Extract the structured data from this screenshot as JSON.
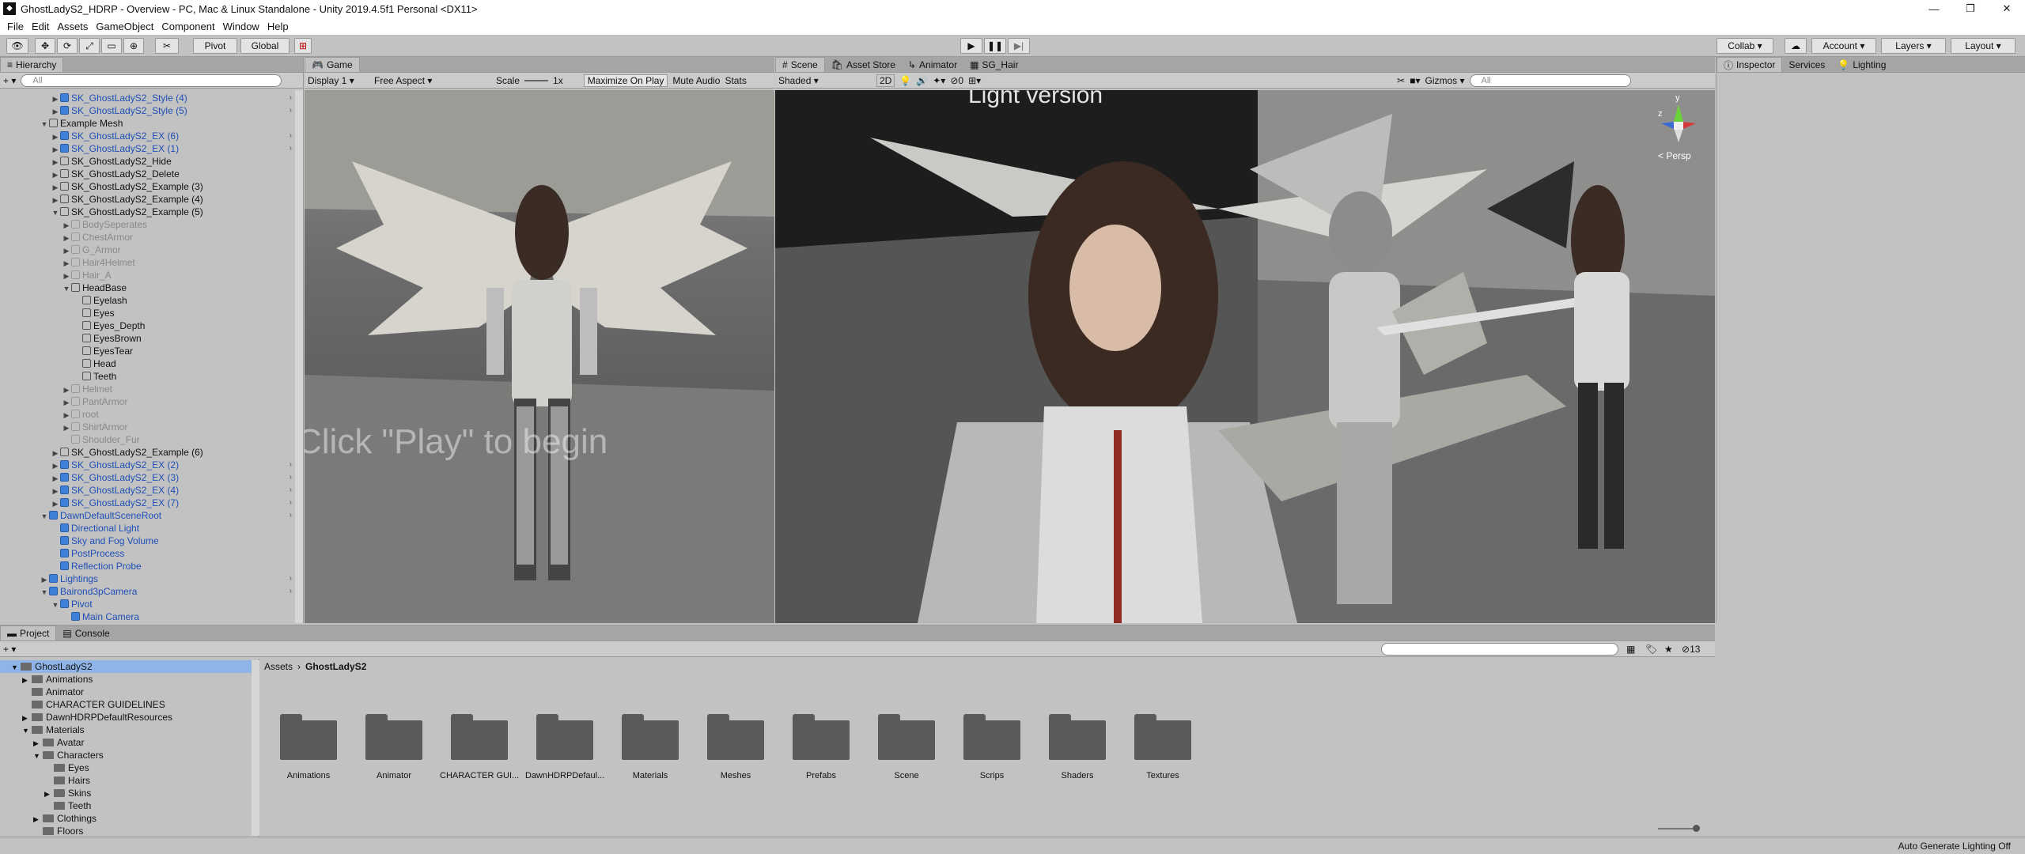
{
  "window": {
    "title": "GhostLadyS2_HDRP - Overview - PC, Mac & Linux Standalone - Unity 2019.4.5f1 Personal <DX11>"
  },
  "menu": [
    "File",
    "Edit",
    "Assets",
    "GameObject",
    "Component",
    "Window",
    "Help"
  ],
  "toolbar": {
    "pivot": "Pivot",
    "global": "Global",
    "collab": "Collab",
    "account": "Account",
    "layers": "Layers",
    "layout": "Layout"
  },
  "hierarchy": {
    "tab": "Hierarchy",
    "search_placeholder": "All",
    "rows": [
      {
        "label": "SK_GhostLadyS2_Style (4)",
        "indent": 1,
        "style": "blue",
        "arrow": "▶",
        "more": true
      },
      {
        "label": "SK_GhostLadyS2_Style (5)",
        "indent": 1,
        "style": "blue",
        "arrow": "▶",
        "more": true
      },
      {
        "label": "Example Mesh",
        "indent": 0,
        "style": "",
        "arrow": "▼",
        "more": false
      },
      {
        "label": "SK_GhostLadyS2_EX (6)",
        "indent": 1,
        "style": "blue",
        "arrow": "▶",
        "more": true
      },
      {
        "label": "SK_GhostLadyS2_EX (1)",
        "indent": 1,
        "style": "blue",
        "arrow": "▶",
        "more": true
      },
      {
        "label": "SK_GhostLadyS2_Hide",
        "indent": 1,
        "style": "",
        "arrow": "▶",
        "more": false
      },
      {
        "label": "SK_GhostLadyS2_Delete",
        "indent": 1,
        "style": "",
        "arrow": "▶",
        "more": false
      },
      {
        "label": "SK_GhostLadyS2_Example (3)",
        "indent": 1,
        "style": "",
        "arrow": "▶",
        "more": false
      },
      {
        "label": "SK_GhostLadyS2_Example (4)",
        "indent": 1,
        "style": "",
        "arrow": "▶",
        "more": false
      },
      {
        "label": "SK_GhostLadyS2_Example (5)",
        "indent": 1,
        "style": "",
        "arrow": "▼",
        "more": false
      },
      {
        "label": "BodySeperates",
        "indent": 2,
        "style": "grey",
        "arrow": "▶",
        "more": false
      },
      {
        "label": "ChestArmor",
        "indent": 2,
        "style": "grey",
        "arrow": "▶",
        "more": false
      },
      {
        "label": "G_Armor",
        "indent": 2,
        "style": "grey",
        "arrow": "▶",
        "more": false
      },
      {
        "label": "Hair4Helmet",
        "indent": 2,
        "style": "grey",
        "arrow": "▶",
        "more": false
      },
      {
        "label": "Hair_A",
        "indent": 2,
        "style": "grey",
        "arrow": "▶",
        "more": false
      },
      {
        "label": "HeadBase",
        "indent": 2,
        "style": "",
        "arrow": "▼",
        "more": false
      },
      {
        "label": "Eyelash",
        "indent": 3,
        "style": "",
        "arrow": "",
        "more": false
      },
      {
        "label": "Eyes",
        "indent": 3,
        "style": "",
        "arrow": "",
        "more": false
      },
      {
        "label": "Eyes_Depth",
        "indent": 3,
        "style": "",
        "arrow": "",
        "more": false
      },
      {
        "label": "EyesBrown",
        "indent": 3,
        "style": "",
        "arrow": "",
        "more": false
      },
      {
        "label": "EyesTear",
        "indent": 3,
        "style": "",
        "arrow": "",
        "more": false
      },
      {
        "label": "Head",
        "indent": 3,
        "style": "",
        "arrow": "",
        "more": false
      },
      {
        "label": "Teeth",
        "indent": 3,
        "style": "",
        "arrow": "",
        "more": false
      },
      {
        "label": "Helmet",
        "indent": 2,
        "style": "grey",
        "arrow": "▶",
        "more": false
      },
      {
        "label": "PantArmor",
        "indent": 2,
        "style": "grey",
        "arrow": "▶",
        "more": false
      },
      {
        "label": "root",
        "indent": 2,
        "style": "grey",
        "arrow": "▶",
        "more": false
      },
      {
        "label": "ShirtArmor",
        "indent": 2,
        "style": "grey",
        "arrow": "▶",
        "more": false
      },
      {
        "label": "Shoulder_Fur",
        "indent": 2,
        "style": "grey",
        "arrow": "",
        "more": false
      },
      {
        "label": "SK_GhostLadyS2_Example (6)",
        "indent": 1,
        "style": "",
        "arrow": "▶",
        "more": false
      },
      {
        "label": "SK_GhostLadyS2_EX (2)",
        "indent": 1,
        "style": "blue",
        "arrow": "▶",
        "more": true
      },
      {
        "label": "SK_GhostLadyS2_EX (3)",
        "indent": 1,
        "style": "blue",
        "arrow": "▶",
        "more": true
      },
      {
        "label": "SK_GhostLadyS2_EX (4)",
        "indent": 1,
        "style": "blue",
        "arrow": "▶",
        "more": true
      },
      {
        "label": "SK_GhostLadyS2_EX (7)",
        "indent": 1,
        "style": "blue",
        "arrow": "▶",
        "more": true
      },
      {
        "label": "DawnDefaultSceneRoot",
        "indent": 0,
        "style": "blue",
        "arrow": "▼",
        "more": true
      },
      {
        "label": "Directional Light",
        "indent": 1,
        "style": "blue",
        "arrow": "",
        "more": false
      },
      {
        "label": "Sky and Fog Volume",
        "indent": 1,
        "style": "blue",
        "arrow": "",
        "more": false
      },
      {
        "label": "PostProcess",
        "indent": 1,
        "style": "blue",
        "arrow": "",
        "more": false
      },
      {
        "label": "Reflection Probe",
        "indent": 1,
        "style": "blue",
        "arrow": "",
        "more": false
      },
      {
        "label": "Lightings",
        "indent": 0,
        "style": "blue",
        "arrow": "▶",
        "more": true
      },
      {
        "label": "Bairond3pCamera",
        "indent": 0,
        "style": "blue",
        "arrow": "▼",
        "more": true
      },
      {
        "label": "Pivot",
        "indent": 1,
        "style": "blue",
        "arrow": "▼",
        "more": false
      },
      {
        "label": "Main Camera",
        "indent": 2,
        "style": "blue",
        "arrow": "",
        "more": false
      }
    ]
  },
  "game": {
    "tab": "Game",
    "display": "Display 1",
    "aspect": "Free Aspect",
    "scale_label": "Scale",
    "scale_value": "1x",
    "maximize": "Maximize On Play",
    "mute": "Mute Audio",
    "stats": "Stats",
    "overlay_text": "Click \"Play\" to begin"
  },
  "scene": {
    "tabs": [
      "Scene",
      "Asset Store",
      "Animator",
      "SG_Hair"
    ],
    "shading": "Shaded",
    "mode2d": "2D",
    "hidden_count": "0",
    "gizmos": "Gizmos",
    "search_placeholder": "All",
    "persp": "< Persp",
    "axis_y": "y",
    "axis_z": "z",
    "overlay_text": "Light version"
  },
  "inspector": {
    "tabs": [
      "Inspector",
      "Services",
      "Lighting"
    ]
  },
  "project": {
    "tabs": [
      "Project",
      "Console"
    ],
    "count": "13",
    "breadcrumb": [
      "Assets",
      "GhostLadyS2"
    ],
    "tree": [
      {
        "label": "GhostLadyS2",
        "indent": 0,
        "arrow": "▼"
      },
      {
        "label": "Animations",
        "indent": 1,
        "arrow": "▶"
      },
      {
        "label": "Animator",
        "indent": 1,
        "arrow": ""
      },
      {
        "label": "CHARACTER GUIDELINES",
        "indent": 1,
        "arrow": ""
      },
      {
        "label": "DawnHDRPDefaultResources",
        "indent": 1,
        "arrow": "▶"
      },
      {
        "label": "Materials",
        "indent": 1,
        "arrow": "▼"
      },
      {
        "label": "Avatar",
        "indent": 2,
        "arrow": "▶"
      },
      {
        "label": "Characters",
        "indent": 2,
        "arrow": "▼"
      },
      {
        "label": "Eyes",
        "indent": 3,
        "arrow": ""
      },
      {
        "label": "Hairs",
        "indent": 3,
        "arrow": ""
      },
      {
        "label": "Skins",
        "indent": 3,
        "arrow": "▶"
      },
      {
        "label": "Teeth",
        "indent": 3,
        "arrow": ""
      },
      {
        "label": "Clothings",
        "indent": 2,
        "arrow": "▶"
      },
      {
        "label": "Floors",
        "indent": 2,
        "arrow": ""
      }
    ],
    "folders": [
      "Animations",
      "Animator",
      "CHARACTER GUI...",
      "DawnHDRPDefaul...",
      "Materials",
      "Meshes",
      "Prefabs",
      "Scene",
      "Scrips",
      "Shaders",
      "Textures"
    ]
  },
  "status": {
    "right": "Auto Generate Lighting Off"
  }
}
